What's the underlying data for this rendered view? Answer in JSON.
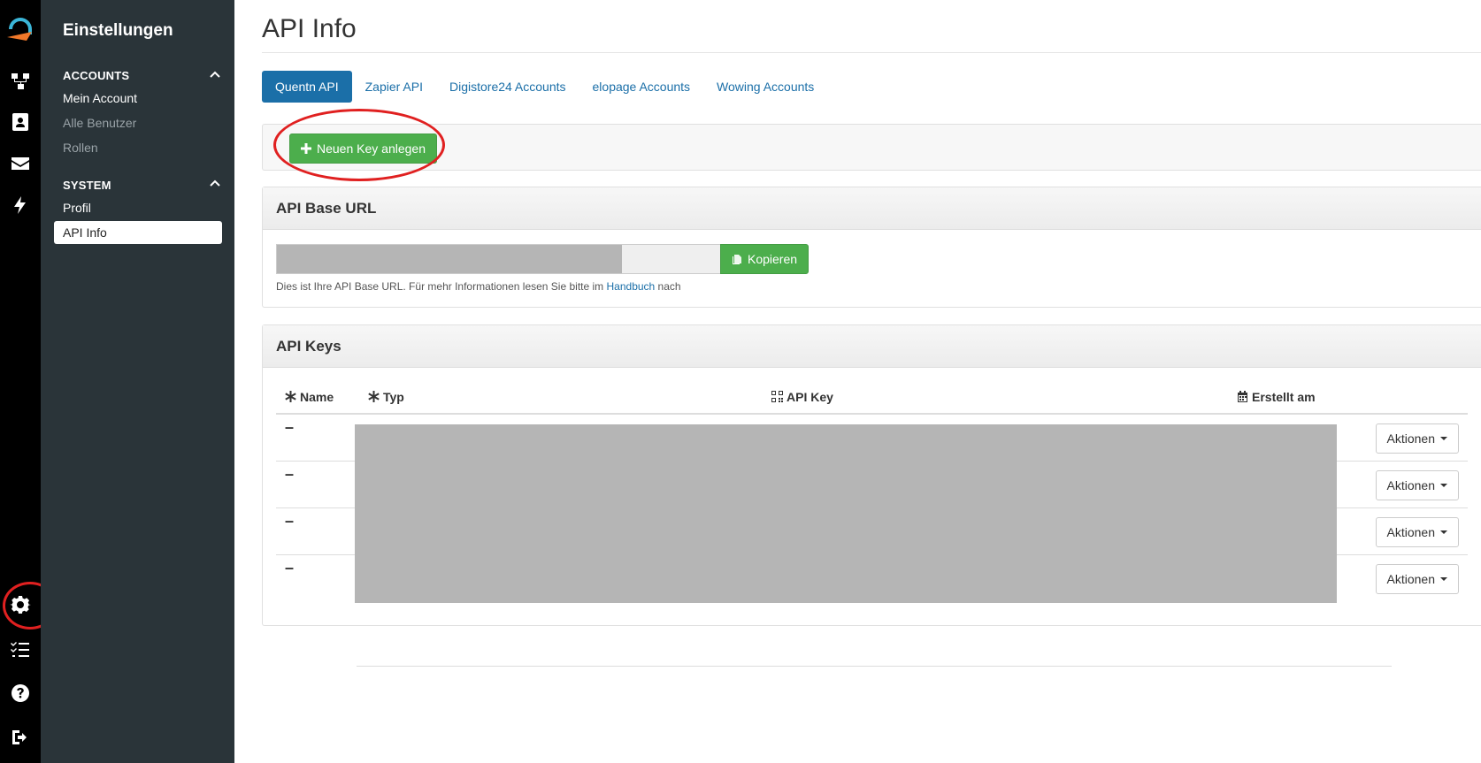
{
  "rail": {
    "icons": [
      "logo-icon",
      "flow-icon",
      "contacts-icon",
      "mail-icon",
      "bolt-icon",
      "gear-icon",
      "checklist-icon",
      "help-icon",
      "logout-icon"
    ]
  },
  "sidebar": {
    "title": "Einstellungen",
    "sections": [
      {
        "label": "ACCOUNTS",
        "items": [
          "Mein Account",
          "Alle Benutzer",
          "Rollen"
        ]
      },
      {
        "label": "SYSTEM",
        "items": [
          "Profil",
          "API Info"
        ]
      }
    ]
  },
  "main": {
    "title": "API Info",
    "tabs": [
      "Quentn API",
      "Zapier API",
      "Digistore24 Accounts",
      "elopage Accounts",
      "Wowing Accounts"
    ],
    "new_key_button": "Neuen Key anlegen",
    "base_url": {
      "heading": "API Base URL",
      "copy_button": "Kopieren",
      "hint_before": "Dies ist Ihre API Base URL. Für mehr Informationen lesen Sie bitte im ",
      "hint_link": "Handbuch",
      "hint_after": " nach"
    },
    "keys": {
      "heading": "API Keys",
      "columns": [
        "Name",
        "Typ",
        "API Key",
        "Erstellt am"
      ],
      "rows": [
        {
          "name": "–",
          "action": "Aktionen"
        },
        {
          "name": "–",
          "action": "Aktionen"
        },
        {
          "name": "–",
          "action": "Aktionen"
        },
        {
          "name": "–",
          "action": "Aktionen"
        }
      ]
    }
  },
  "colors": {
    "accent": "#1b6fa8",
    "success": "#4cae4c",
    "highlight": "#e02020",
    "sidebar": "#2a3439"
  }
}
